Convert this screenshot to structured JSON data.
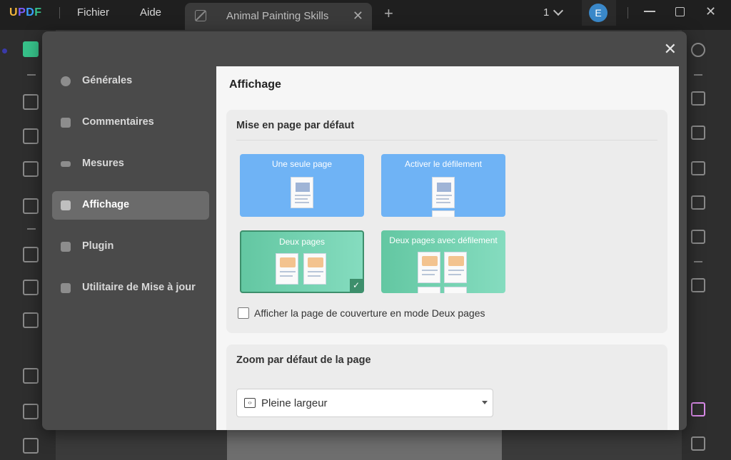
{
  "app": {
    "logo": "UPDF",
    "menu": [
      "Fichier",
      "Aide"
    ],
    "tab_title": "Animal Painting Skills",
    "page_count": "1",
    "avatar_initial": "E"
  },
  "dialog": {
    "nav": [
      {
        "label": "Générales",
        "icon": "gear-icon",
        "active": false
      },
      {
        "label": "Commentaires",
        "icon": "comment-icon",
        "active": false
      },
      {
        "label": "Mesures",
        "icon": "ruler-icon",
        "active": false
      },
      {
        "label": "Affichage",
        "icon": "book-icon",
        "active": true
      },
      {
        "label": "Plugin",
        "icon": "puzzle-icon",
        "active": false
      },
      {
        "label": "Utilitaire de Mise à jour",
        "icon": "download-icon",
        "active": false
      }
    ],
    "panel_title": "Affichage",
    "layout_section": {
      "title": "Mise en page par défaut",
      "options": [
        {
          "label": "Une seule page",
          "selected": false
        },
        {
          "label": "Activer le défilement",
          "selected": false
        },
        {
          "label": "Deux pages",
          "selected": true
        },
        {
          "label": "Deux pages avec défilement",
          "selected": false
        }
      ],
      "cover_checkbox_label": "Afficher la page de couverture en mode Deux pages",
      "cover_checked": false
    },
    "zoom_section": {
      "title": "Zoom par défaut de la page",
      "selected": "Pleine largeur"
    }
  },
  "colors": {
    "accent_green": "#3d8f6c",
    "option_blue": "#6fb3f5",
    "option_green": "#63c7a2",
    "avatar": "#3a88c9"
  }
}
